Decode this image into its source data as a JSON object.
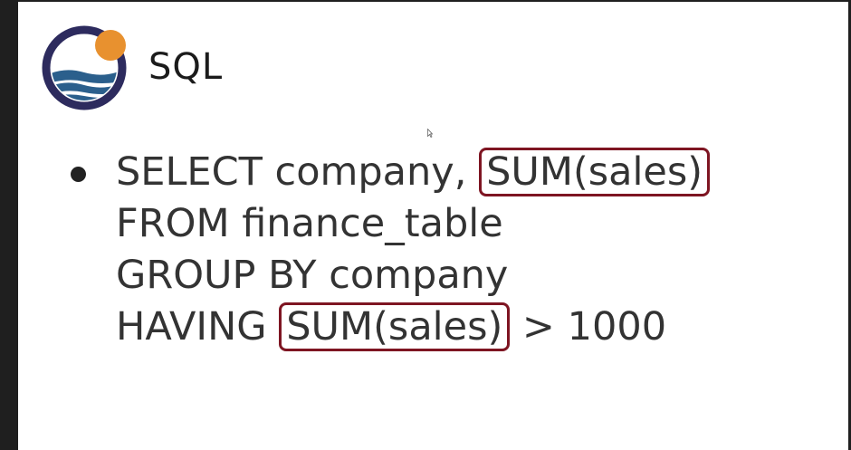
{
  "slide": {
    "title": "SQL",
    "logo_icon": "sun-over-waves-logo",
    "colors": {
      "logo_ring": "#2d2b5e",
      "logo_sun": "#e8912f",
      "logo_waves": "#2b5f8c",
      "highlight_border": "#7e1522",
      "text": "#333333"
    },
    "bullet": {
      "line1": {
        "before": "SELECT company, ",
        "highlight": "SUM(sales)"
      },
      "line2": "FROM finance_table",
      "line3": "GROUP BY company",
      "line4": {
        "before": "HAVING ",
        "highlight": "SUM(sales)",
        "after": " > 1000"
      }
    }
  }
}
